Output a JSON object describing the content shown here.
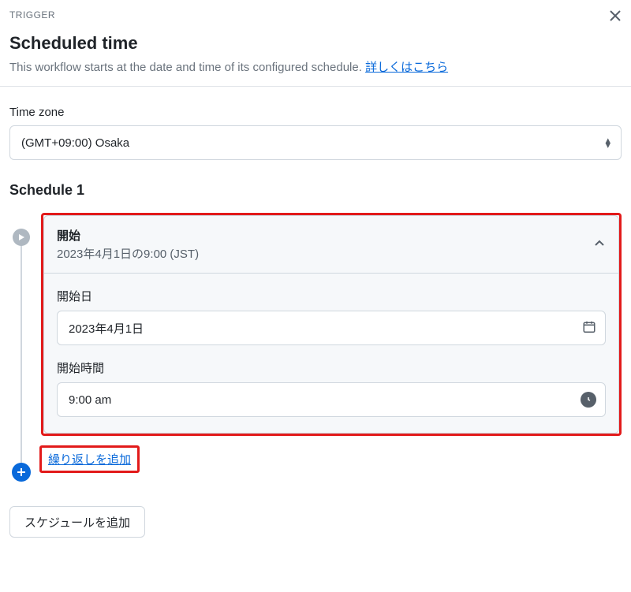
{
  "eyebrow": "TRIGGER",
  "title": "Scheduled time",
  "subtitle": "This workflow starts at the date and time of its configured schedule. ",
  "learn_more": "詳しくはこちら",
  "timezone": {
    "label": "Time zone",
    "value": "(GMT+09:00) Osaka"
  },
  "schedule": {
    "heading": "Schedule 1",
    "start": {
      "label": "開始",
      "summary": "2023年4月1日の9:00 (JST)",
      "date_label": "開始日",
      "date_value": "2023年4月1日",
      "time_label": "開始時間",
      "time_value": "9:00 am"
    },
    "add_repeat": "繰り返しを追加",
    "add_schedule": "スケジュールを追加"
  }
}
